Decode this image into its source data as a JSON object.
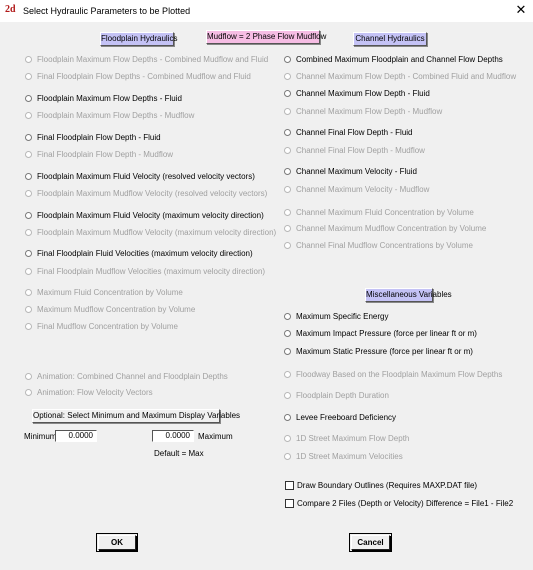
{
  "window": {
    "title": "Select Hydraulic Parameters to be Plotted",
    "close_glyph": "✕",
    "app_icon_text": "2d"
  },
  "headers": {
    "floodplain": "Floodplain Hydraulics",
    "mudflow": "Mudflow = 2 Phase Flow Mudflow",
    "channel": "Channel Hydraulics",
    "misc": "Miscellaneous Variables"
  },
  "floodplain_items": [
    {
      "label": "Floodplain Maximum Flow Depths - Combined Mudflow and Fluid",
      "enabled": false
    },
    {
      "label": "Final Floodplain Flow Depths - Combined Mudflow and Fluid",
      "enabled": false
    },
    {
      "label": "Floodplain Maximum Flow Depths - Fluid",
      "enabled": true
    },
    {
      "label": "Floodplain Maximum Flow Depths - Mudflow",
      "enabled": false
    },
    {
      "label": "Final Floodplain Flow Depth - Fluid",
      "enabled": true
    },
    {
      "label": "Final Floodplain Flow Depth - Mudflow",
      "enabled": false
    },
    {
      "label": "Floodplain Maximum Fluid Velocity (resolved velocity vectors)",
      "enabled": true
    },
    {
      "label": "Floodplain Maximum Mudflow Velocity (resolved velocity vectors)",
      "enabled": false
    },
    {
      "label": "Floodplain Maximum Fluid Velocity (maximum velocity direction)",
      "enabled": true
    },
    {
      "label": "Floodplain Maximum Mudflow Velocity (maximum velocity direction)",
      "enabled": false
    },
    {
      "label": "Final Floodplain Fluid Velocities (maximum velocity direction)",
      "enabled": true
    },
    {
      "label": "Final Floodplain Mudflow Velocities (maximum velocity direction)",
      "enabled": false
    },
    {
      "label": "Maximum Fluid Concentration by Volume",
      "enabled": false
    },
    {
      "label": "Maximum Mudflow Concentration by Volume",
      "enabled": false
    },
    {
      "label": "Final Mudflow Concentration by Volume",
      "enabled": false
    }
  ],
  "animation_items": [
    {
      "label": "Animation:  Combined Channel and Floodplain Depths",
      "enabled": false
    },
    {
      "label": "Animation:  Flow Velocity Vectors",
      "enabled": false
    }
  ],
  "channel_items": [
    {
      "label": "Combined Maximum Floodplain and Channel Flow Depths",
      "enabled": true
    },
    {
      "label": "Channel Maximum Flow Depth - Combined Fluid and Mudflow",
      "enabled": false
    },
    {
      "label": "Channel Maximum Flow Depth - Fluid",
      "enabled": true
    },
    {
      "label": "Channel Maximum Flow Depth - Mudflow",
      "enabled": false
    },
    {
      "label": "Channel Final Flow Depth - Fluid",
      "enabled": true
    },
    {
      "label": "Channel Final Flow Depth - Mudflow",
      "enabled": false
    },
    {
      "label": "Channel Maximum Velocity - Fluid",
      "enabled": true
    },
    {
      "label": "Channel Maximum Velocity - Mudflow",
      "enabled": false
    },
    {
      "label": "Channel Maximum Fluid Concentration by Volume",
      "enabled": false
    },
    {
      "label": "Channel Maximum Mudflow Concentration by Volume",
      "enabled": false
    },
    {
      "label": "Channel Final Mudflow Concentrations by Volume",
      "enabled": false
    }
  ],
  "misc_items": [
    {
      "label": "Maximum Specific Energy",
      "enabled": true
    },
    {
      "label": "Maximum Impact Pressure (force per linear ft or m)",
      "enabled": true
    },
    {
      "label": "Maximum Static Pressure (force per linear ft or m)",
      "enabled": true
    },
    {
      "label": "Floodway Based on the Floodplain Maximum Flow Depths",
      "enabled": false
    },
    {
      "label": "Floodplain Depth Duration",
      "enabled": false
    },
    {
      "label": "Levee Freeboard Deficiency",
      "enabled": true
    },
    {
      "label": "1D Street Maximum Flow Depth",
      "enabled": false
    },
    {
      "label": "1D Street Maximum Velocities",
      "enabled": false
    }
  ],
  "checkboxes": [
    {
      "label": "Draw Boundary Outlines (Requires MAXP.DAT file)"
    },
    {
      "label": "Compare 2 Files (Depth or Velocity)   Difference = File1 - File2"
    }
  ],
  "optional": {
    "label": "Optional:  Select Minimum and Maximum Display Variables",
    "min_label": "Minimum",
    "min_value": "0.0000",
    "max_value": "0.0000",
    "max_label": "Maximum",
    "default_note": "Default = Max"
  },
  "buttons": {
    "ok": "OK",
    "cancel": "Cancel"
  }
}
